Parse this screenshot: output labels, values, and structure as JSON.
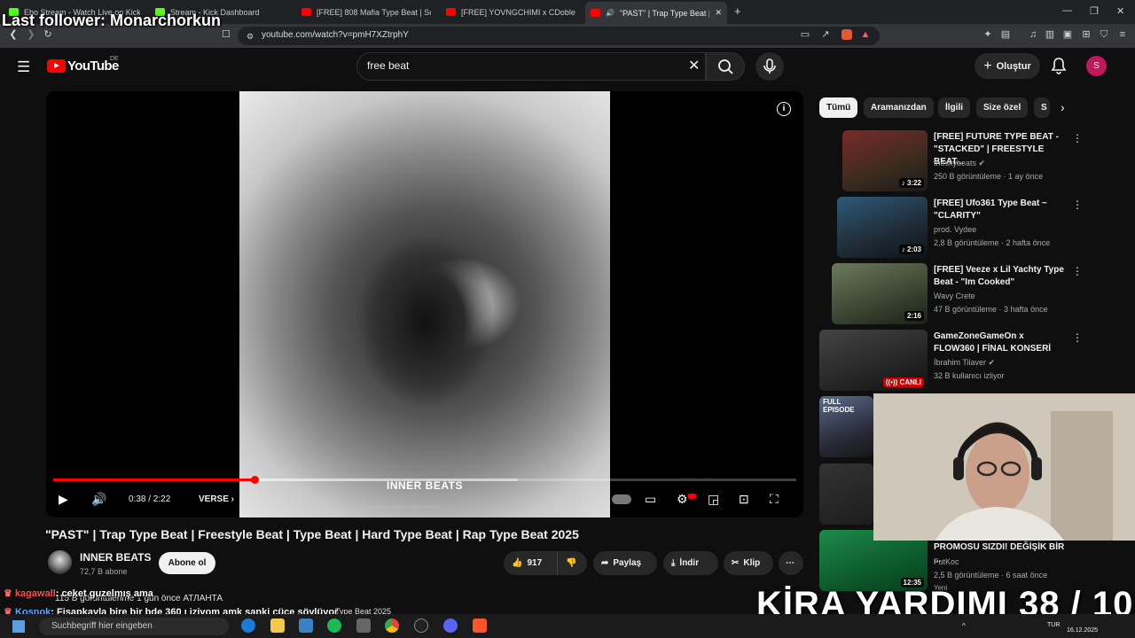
{
  "browser": {
    "tabs": [
      {
        "title": "Ebo Stream - Watch Live on Kick",
        "color": "#53fc18"
      },
      {
        "title": "Stream - Kick Dashboard",
        "color": "#53fc18"
      },
      {
        "title": "[FREE] 808 Mafia Type Beat | Southsi",
        "color": "#ff0000"
      },
      {
        "title": "[FREE] YOVNGCHIMI x CDobleta Type",
        "color": "#ff0000"
      },
      {
        "title": "\"PAST\" | Trap Type Beat | Free",
        "color": "#ff0000"
      }
    ],
    "new_tab": "+",
    "url": "youtube.com/watch?v=pmH7XZtrphY"
  },
  "overlay": {
    "last_follower": "Last follower: Monarchorkun",
    "kira": "KİRA YARDIMI  38 / 100",
    "chat": [
      {
        "user": "kagawall",
        "text": "ceket guzelmış ama",
        "user_color": "#ff4d4d"
      },
      {
        "user": "Kosnok",
        "text": "Fisapkayla bire bir bde 360 ı iziyom amk sanki cüce söylüyor",
        "user_color": "#5fa8ff"
      },
      {
        "user": "asdfasdfasdf",
        "text": "",
        "user_color": "#ffffff"
      }
    ]
  },
  "youtube": {
    "logo_text": "YouTube",
    "country": "DE",
    "search_value": "free beat",
    "create_label": "Oluştur",
    "avatar_letter": "S"
  },
  "player": {
    "time": "0:38 / 2:22",
    "chapter": "VERSE",
    "progress": 0.271,
    "buffered": 0.625,
    "watermark": "INNER BEATS",
    "copyright": "Copyright © INNER. All rights reserved."
  },
  "video": {
    "title": "\"PAST\" | Trap Type Beat | Freestyle Beat | Type Beat | Hard Type Beat | Rap Type Beat 2025",
    "channel": "INNER BEATS",
    "subscribers": "72,7 B abone",
    "subscribe_label": "Abone ol",
    "likes": "917",
    "share_label": "Paylaş",
    "download_label": "İndir",
    "clip_label": "Klip",
    "views_line": "115 B görüntülenme  1 gün önce  АТЛАНТА",
    "tags_line": "Type Beat 2025"
  },
  "chips": [
    "Tümü",
    "Aramanızdan",
    "İlgili",
    "Size özel",
    "S"
  ],
  "recommended": [
    {
      "title": "[FREE] FUTURE TYPE BEAT - \"STACKED\" | FREESTYLE BEAT...",
      "channel": "theskybeats",
      "stats": "250 B görüntüleme · 1 ay önce",
      "duration": "3:22",
      "verified": true
    },
    {
      "title": "[FREE] Ufo361 Type Beat ~ \"CLARITY\"",
      "channel": "prod. Vydee",
      "stats": "2,8 B görüntüleme · 2 hafta önce",
      "duration": "2:03",
      "verified": false
    },
    {
      "title": "[FREE] Veeze x Lil Yachty Type Beat - \"Im Cooked\"",
      "channel": "Wavy Crete",
      "stats": "47 B görüntüleme · 3 hafta önce",
      "duration": "2:16",
      "verified": false
    },
    {
      "title": "GameZoneGameOn x FLOW360 | FİNAL KONSERİ",
      "channel": "İbrahim Tilaver",
      "stats": "32 B kullanıcı izliyor",
      "duration": "CANLI",
      "verified": true
    },
    {
      "title": "FULL EPISODE",
      "channel": "",
      "stats": "",
      "duration": "",
      "verified": false
    },
    {
      "title": "PROMOSU SIZDI! DEĞİŞİK BİR ...",
      "channel": "FutKoc",
      "stats": "2,5 B görüntüleme · 6 saat önce",
      "duration": "12:35",
      "verified": false,
      "badge": "Yeni"
    }
  ],
  "taskbar": {
    "search_placeholder": "Suchbegriff hier eingeben",
    "lang": "TUR",
    "date": "16.12.2025"
  }
}
